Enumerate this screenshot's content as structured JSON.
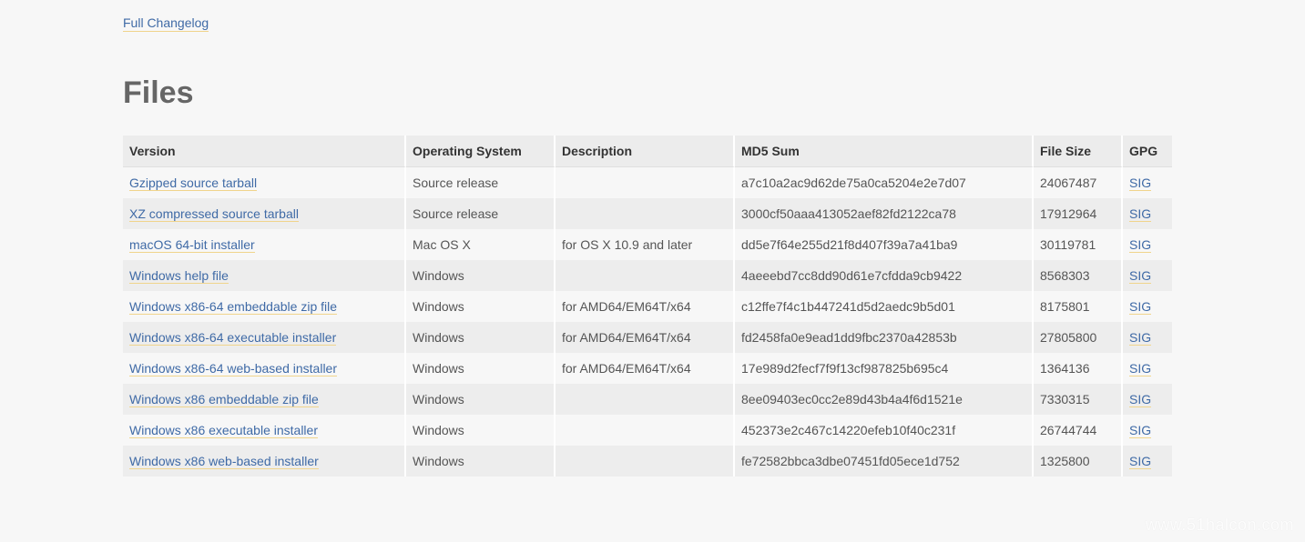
{
  "changelog_link": "Full Changelog",
  "heading": "Files",
  "table": {
    "headers": {
      "version": "Version",
      "os": "Operating System",
      "description": "Description",
      "md5": "MD5 Sum",
      "size": "File Size",
      "gpg": "GPG"
    },
    "rows": [
      {
        "version": "Gzipped source tarball",
        "os": "Source release",
        "description": "",
        "md5": "a7c10a2ac9d62de75a0ca5204e2e7d07",
        "size": "24067487",
        "gpg": "SIG"
      },
      {
        "version": "XZ compressed source tarball",
        "os": "Source release",
        "description": "",
        "md5": "3000cf50aaa413052aef82fd2122ca78",
        "size": "17912964",
        "gpg": "SIG"
      },
      {
        "version": "macOS 64-bit installer",
        "os": "Mac OS X",
        "description": "for OS X 10.9 and later",
        "md5": "dd5e7f64e255d21f8d407f39a7a41ba9",
        "size": "30119781",
        "gpg": "SIG"
      },
      {
        "version": "Windows help file",
        "os": "Windows",
        "description": "",
        "md5": "4aeeebd7cc8dd90d61e7cfdda9cb9422",
        "size": "8568303",
        "gpg": "SIG"
      },
      {
        "version": "Windows x86-64 embeddable zip file",
        "os": "Windows",
        "description": "for AMD64/EM64T/x64",
        "md5": "c12ffe7f4c1b447241d5d2aedc9b5d01",
        "size": "8175801",
        "gpg": "SIG"
      },
      {
        "version": "Windows x86-64 executable installer",
        "os": "Windows",
        "description": "for AMD64/EM64T/x64",
        "md5": "fd2458fa0e9ead1dd9fbc2370a42853b",
        "size": "27805800",
        "gpg": "SIG"
      },
      {
        "version": "Windows x86-64 web-based installer",
        "os": "Windows",
        "description": "for AMD64/EM64T/x64",
        "md5": "17e989d2fecf7f9f13cf987825b695c4",
        "size": "1364136",
        "gpg": "SIG"
      },
      {
        "version": "Windows x86 embeddable zip file",
        "os": "Windows",
        "description": "",
        "md5": "8ee09403ec0cc2e89d43b4a4f6d1521e",
        "size": "7330315",
        "gpg": "SIG"
      },
      {
        "version": "Windows x86 executable installer",
        "os": "Windows",
        "description": "",
        "md5": "452373e2c467c14220efeb10f40c231f",
        "size": "26744744",
        "gpg": "SIG"
      },
      {
        "version": "Windows x86 web-based installer",
        "os": "Windows",
        "description": "",
        "md5": "fe72582bbca3dbe07451fd05ece1d752",
        "size": "1325800",
        "gpg": "SIG"
      }
    ]
  },
  "watermark": "www.51halcon.com",
  "colors": {
    "link": "#3f6aa6",
    "link_underline": "#f0d48c",
    "background": "#f7f7f7",
    "header_bg": "#ececec"
  }
}
